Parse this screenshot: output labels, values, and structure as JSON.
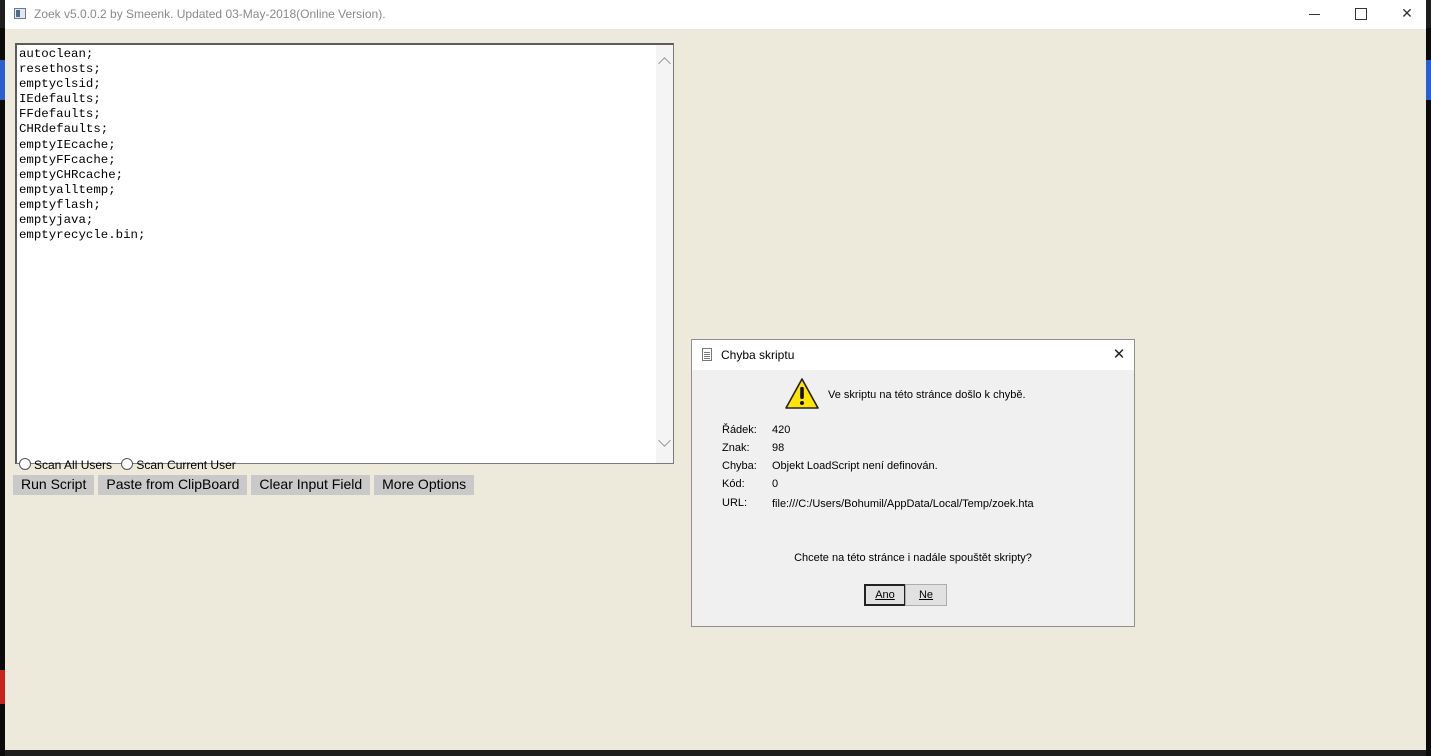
{
  "window": {
    "title": "Zoek v5.0.0.2 by Smeenk. Updated 03-May-2018(Online Version)."
  },
  "editor": {
    "text": "autoclean;\nresethosts;\nemptyclsid;\nIEdefaults;\nFFdefaults;\nCHRdefaults;\nemptyIEcache;\nemptyFFcache;\nemptyCHRcache;\nemptyalltemp;\nemptyflash;\nemptyjava;\nemptyrecycle.bin;"
  },
  "scan_options": {
    "all_users": "Scan All Users",
    "current_user": "Scan Current User"
  },
  "buttons": {
    "run": "Run Script",
    "paste": "Paste from ClipBoard",
    "clear": "Clear Input Field",
    "more": "More Options"
  },
  "dialog": {
    "title": "Chyba skriptu",
    "message": "Ve skriptu na této stránce došlo k chybě.",
    "fields": [
      {
        "label": "Řádek:",
        "value": "420"
      },
      {
        "label": "Znak:",
        "value": "98"
      },
      {
        "label": "Chyba:",
        "value": "Objekt LoadScript není definován."
      },
      {
        "label": "Kód:",
        "value": "0"
      },
      {
        "label": "URL:",
        "value": "file:///C:/Users/Bohumil/AppData/Local/Temp/zoek.hta"
      }
    ],
    "question": "Chcete na této stránce i nadále spouštět skripty?",
    "yes_label": "Ano",
    "no_label": "Ne"
  },
  "icons": {
    "warning": "warning-icon",
    "document": "document-icon",
    "app": "app-icon"
  },
  "colors": {
    "window_bg": "#eeeadb",
    "button_bg": "#c9c9c9",
    "dialog_bg": "#f0f0f0",
    "warning_yellow": "#ffe400"
  }
}
